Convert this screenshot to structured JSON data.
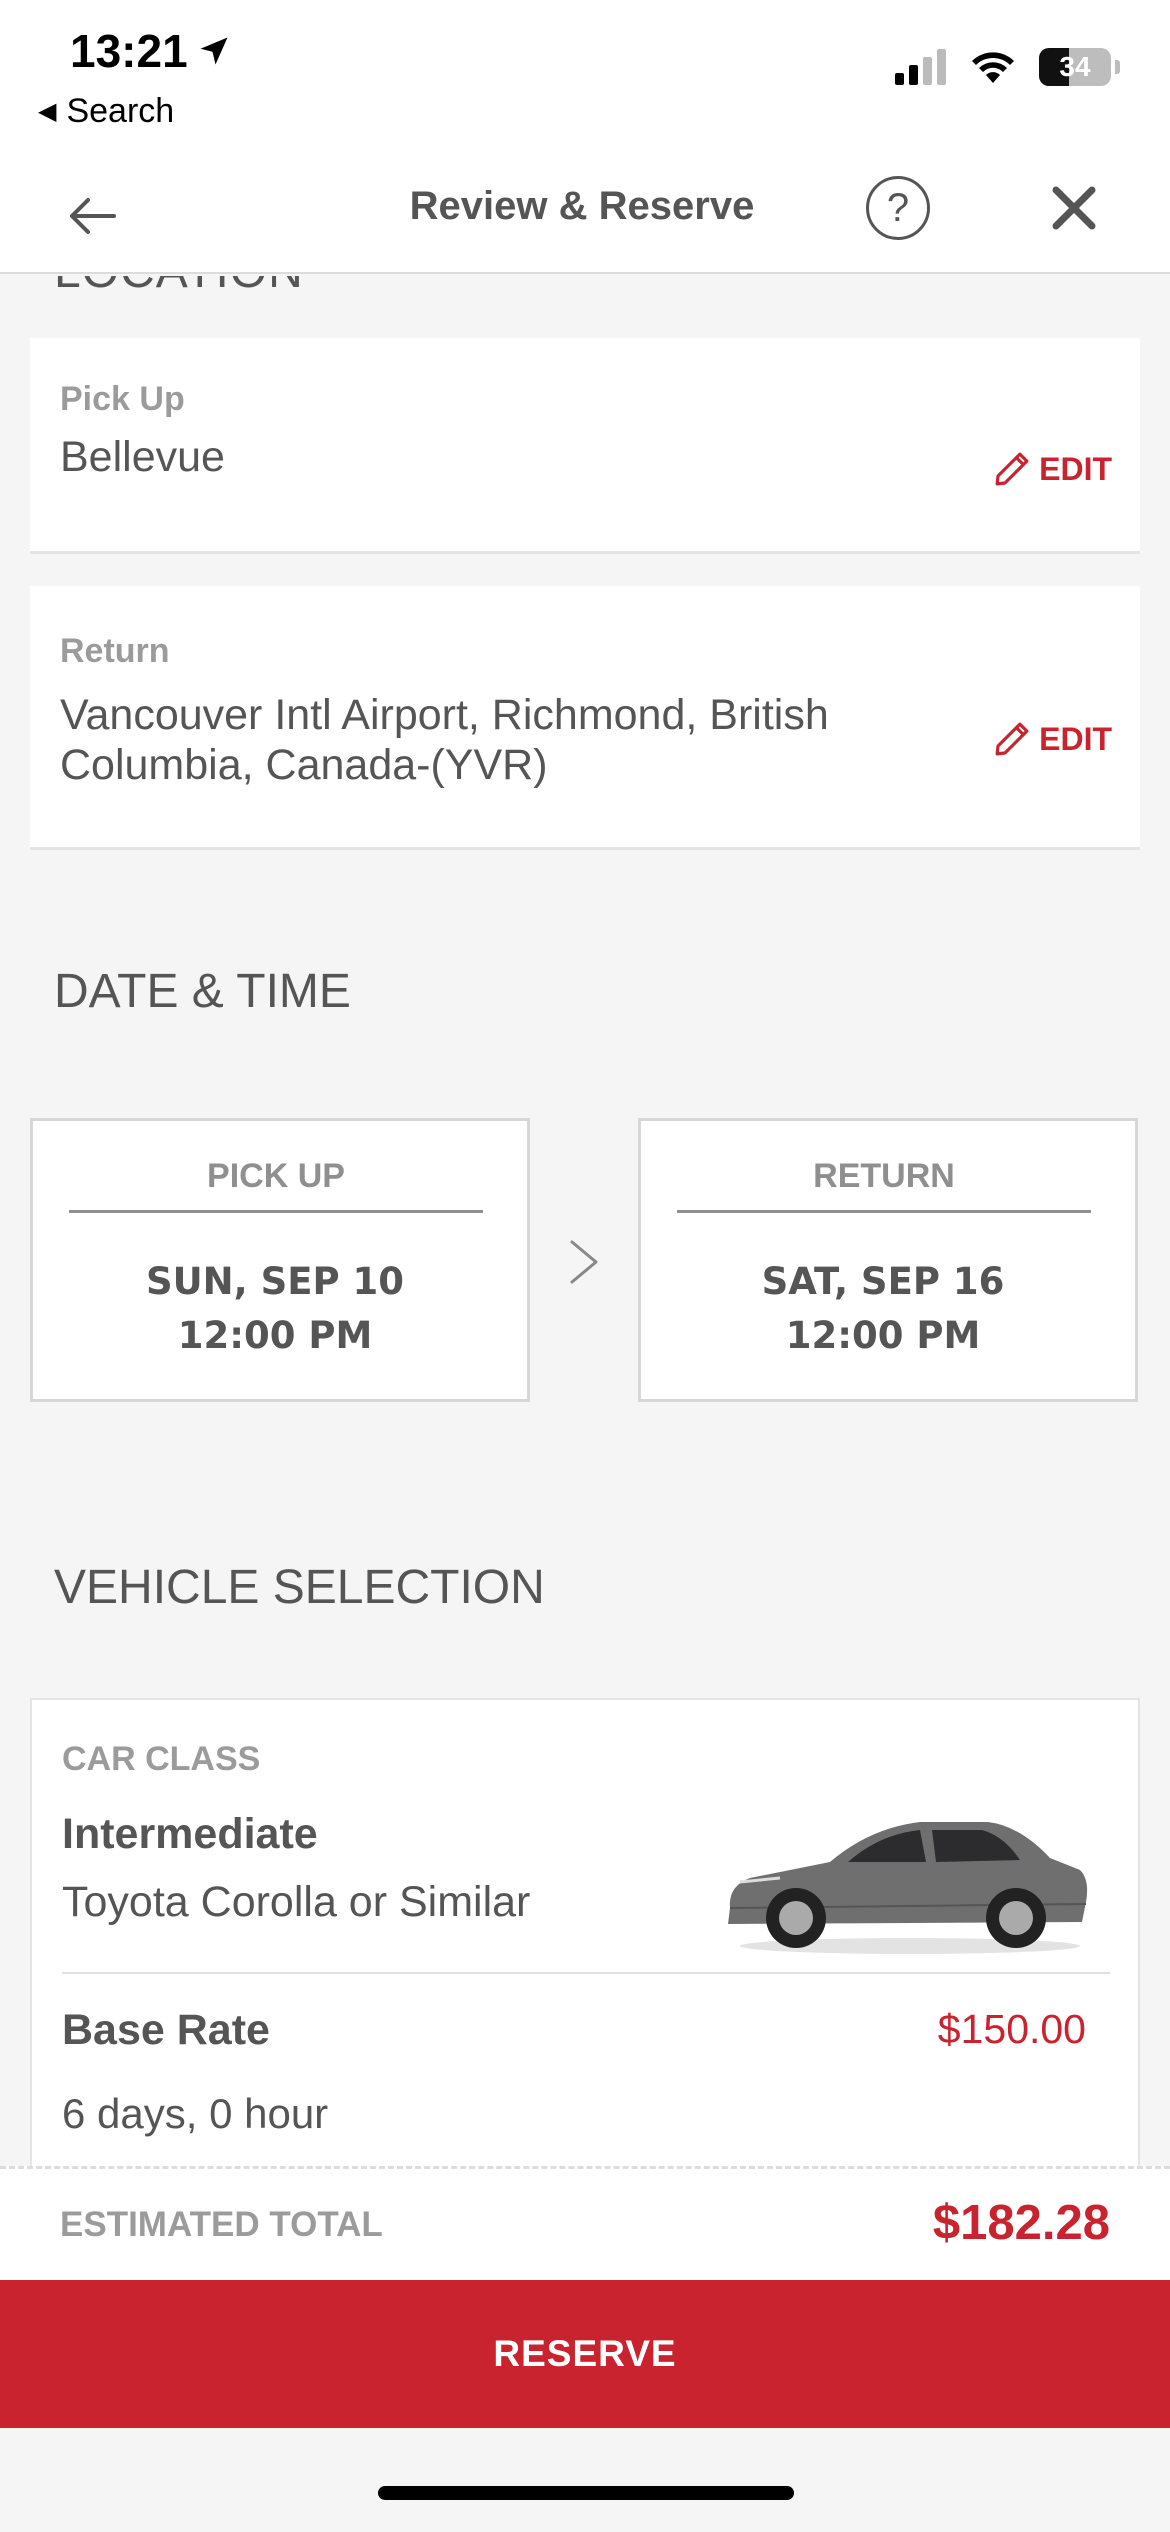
{
  "status_bar": {
    "time": "13:21",
    "back_app": "Search",
    "battery": "34"
  },
  "nav": {
    "title": "Review & Reserve",
    "help_symbol": "?"
  },
  "location": {
    "partial_heading": "LOCATION",
    "pickup": {
      "label": "Pick Up",
      "value": "Bellevue",
      "edit_label": "EDIT"
    },
    "return": {
      "label": "Return",
      "value_line1": "Vancouver Intl Airport, Richmond, British",
      "value_line2": "Columbia, Canada-(YVR)",
      "edit_label": "EDIT"
    }
  },
  "date_time": {
    "title": "DATE & TIME",
    "pickup": {
      "label": "PICK UP",
      "date": "SUN, SEP 10",
      "time": "12:00 PM"
    },
    "return": {
      "label": "RETURN",
      "date": "SAT, SEP 16",
      "time": "12:00 PM"
    }
  },
  "vehicle": {
    "title": "VEHICLE SELECTION",
    "class_label": "CAR CLASS",
    "class_name": "Intermediate",
    "model": "Toyota Corolla or Similar",
    "base_rate_label": "Base Rate",
    "base_rate_value": "$150.00",
    "duration": "6 days, 0 hour"
  },
  "footer": {
    "total_label": "ESTIMATED TOTAL",
    "total_value": "$182.28",
    "reserve_label": "RESERVE"
  },
  "colors": {
    "accent": "#c8232f",
    "background": "#f5f5f5",
    "text": "#555555"
  }
}
